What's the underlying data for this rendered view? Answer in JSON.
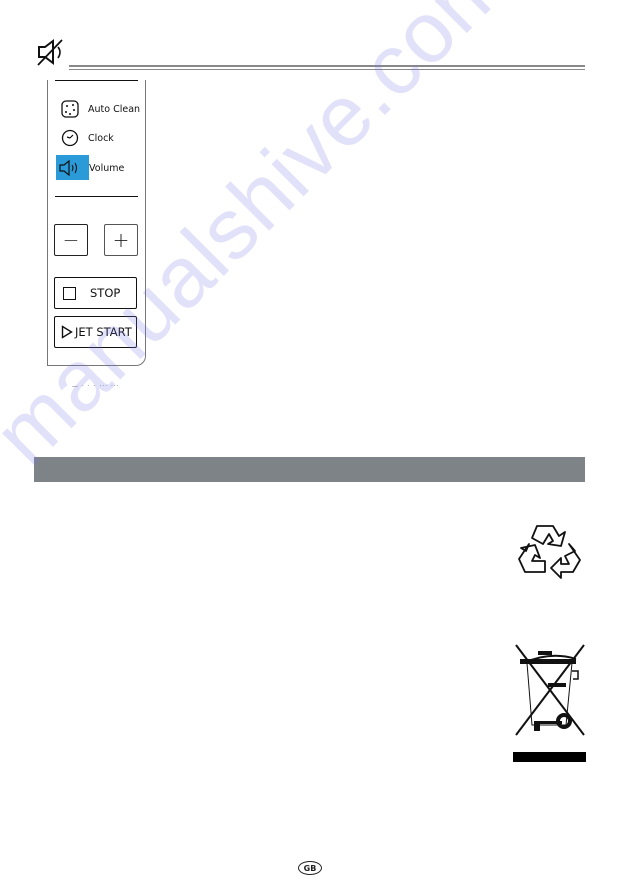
{
  "header": {
    "icon": "speaker-muted-icon"
  },
  "panel": {
    "menu": [
      {
        "label": "Auto Clean",
        "icon": "auto-clean-icon",
        "selected": false
      },
      {
        "label": "Clock",
        "icon": "clock-icon",
        "selected": false
      },
      {
        "label": "Volume",
        "icon": "speaker-icon",
        "selected": true
      }
    ],
    "minus_label": "−",
    "plus_label": "+",
    "stop_label": "STOP",
    "jet_start_label": "JET START",
    "highlight_color": "#2b9ad8"
  },
  "cutoff_text": "— · · · ··· ···",
  "section_bar": {
    "color": "#7e8388"
  },
  "symbols": {
    "recycle": "recycle-icon",
    "weee": "crossed-out-wheelie-bin-icon"
  },
  "footer": {
    "language_badge": "GB"
  },
  "watermark": "manualshive.com"
}
